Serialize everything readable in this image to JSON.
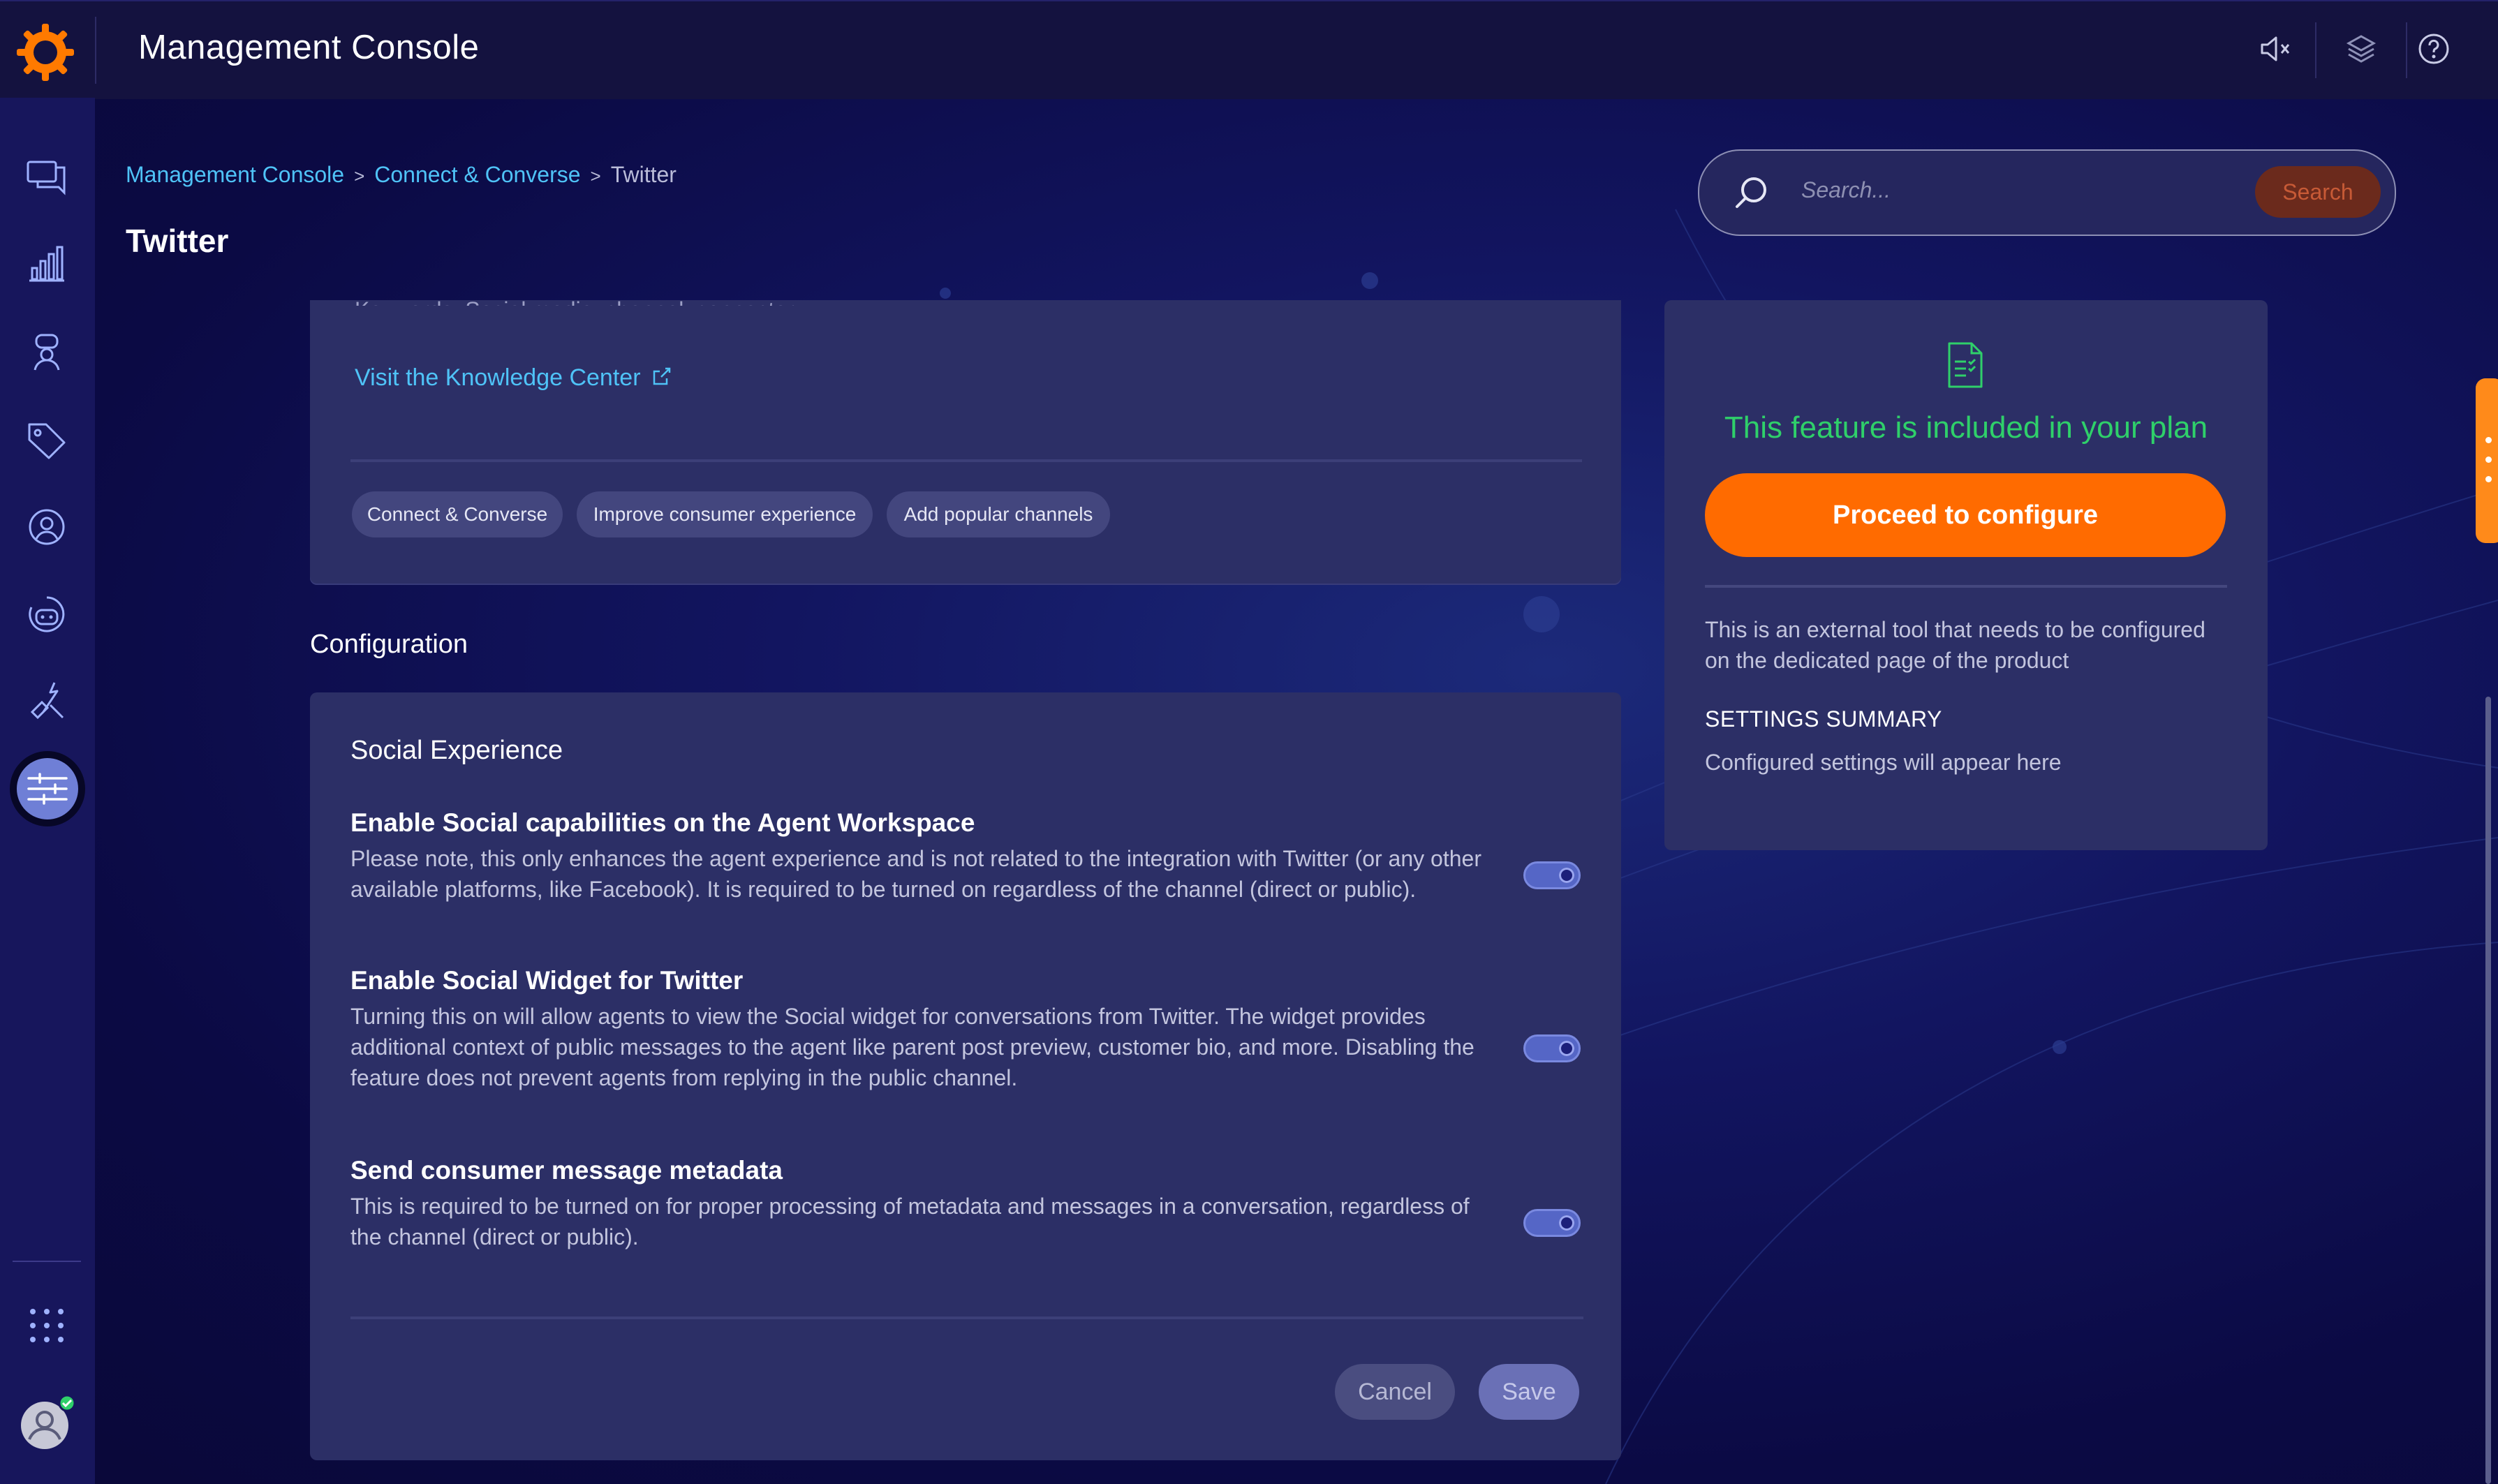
{
  "app": {
    "title": "Management Console"
  },
  "topbar": {
    "icons": [
      "mute-icon",
      "layers-icon",
      "help-icon"
    ]
  },
  "rail": {
    "items": [
      "conversations-icon",
      "analytics-icon",
      "agent-manager-icon",
      "tags-icon",
      "users-icon",
      "bot-icon",
      "automation-icon",
      "management-console-icon",
      "apps-grid-icon",
      "user-avatar-icon"
    ],
    "active": "management-console-icon"
  },
  "breadcrumb": {
    "items": [
      "Management Console",
      "Connect & Converse",
      "Twitter"
    ],
    "separator": ">"
  },
  "page": {
    "title": "Twitter"
  },
  "search": {
    "placeholder": "Search...",
    "button": "Search"
  },
  "overview": {
    "keywords_cutoff": "Keywords: Social media, channel, connector",
    "knowledge_link": "Visit the Knowledge Center",
    "tags": [
      "Connect & Converse",
      "Improve consumer experience",
      "Add popular channels"
    ]
  },
  "configuration": {
    "heading": "Configuration",
    "section": "Social Experience",
    "settings": [
      {
        "title": "Enable Social capabilities on the Agent Workspace",
        "description": "Please note, this only enhances the agent experience and is not related to the integration with Twitter (or any other available platforms, like Facebook). It is required to be turned on regardless of the channel (direct or public).",
        "enabled": true
      },
      {
        "title": "Enable Social Widget for Twitter",
        "description": "Turning this on will allow agents to view the Social widget for conversations from Twitter. The widget provides additional context of public messages to the agent like parent post preview, customer bio, and more. Disabling the feature does not prevent agents from replying in the public channel.",
        "enabled": true
      },
      {
        "title": "Send consumer message metadata",
        "description": "This is required to be turned on for proper processing of metadata and messages in a conversation, regardless of the channel (direct or public).",
        "enabled": true
      }
    ],
    "cancel": "Cancel",
    "save": "Save"
  },
  "plan": {
    "included": "This feature is included in your plan",
    "proceed": "Proceed to configure",
    "external_note": "This is an external tool that needs to be configured on the dedicated page of the product",
    "summary_heading": "SETTINGS SUMMARY",
    "summary_text": "Configured settings will appear here"
  },
  "colors": {
    "accent": "#ff6b00",
    "link": "#4fc3f7",
    "success": "#2fd06a",
    "card": "#2c2f66",
    "rail": "#17165c"
  }
}
